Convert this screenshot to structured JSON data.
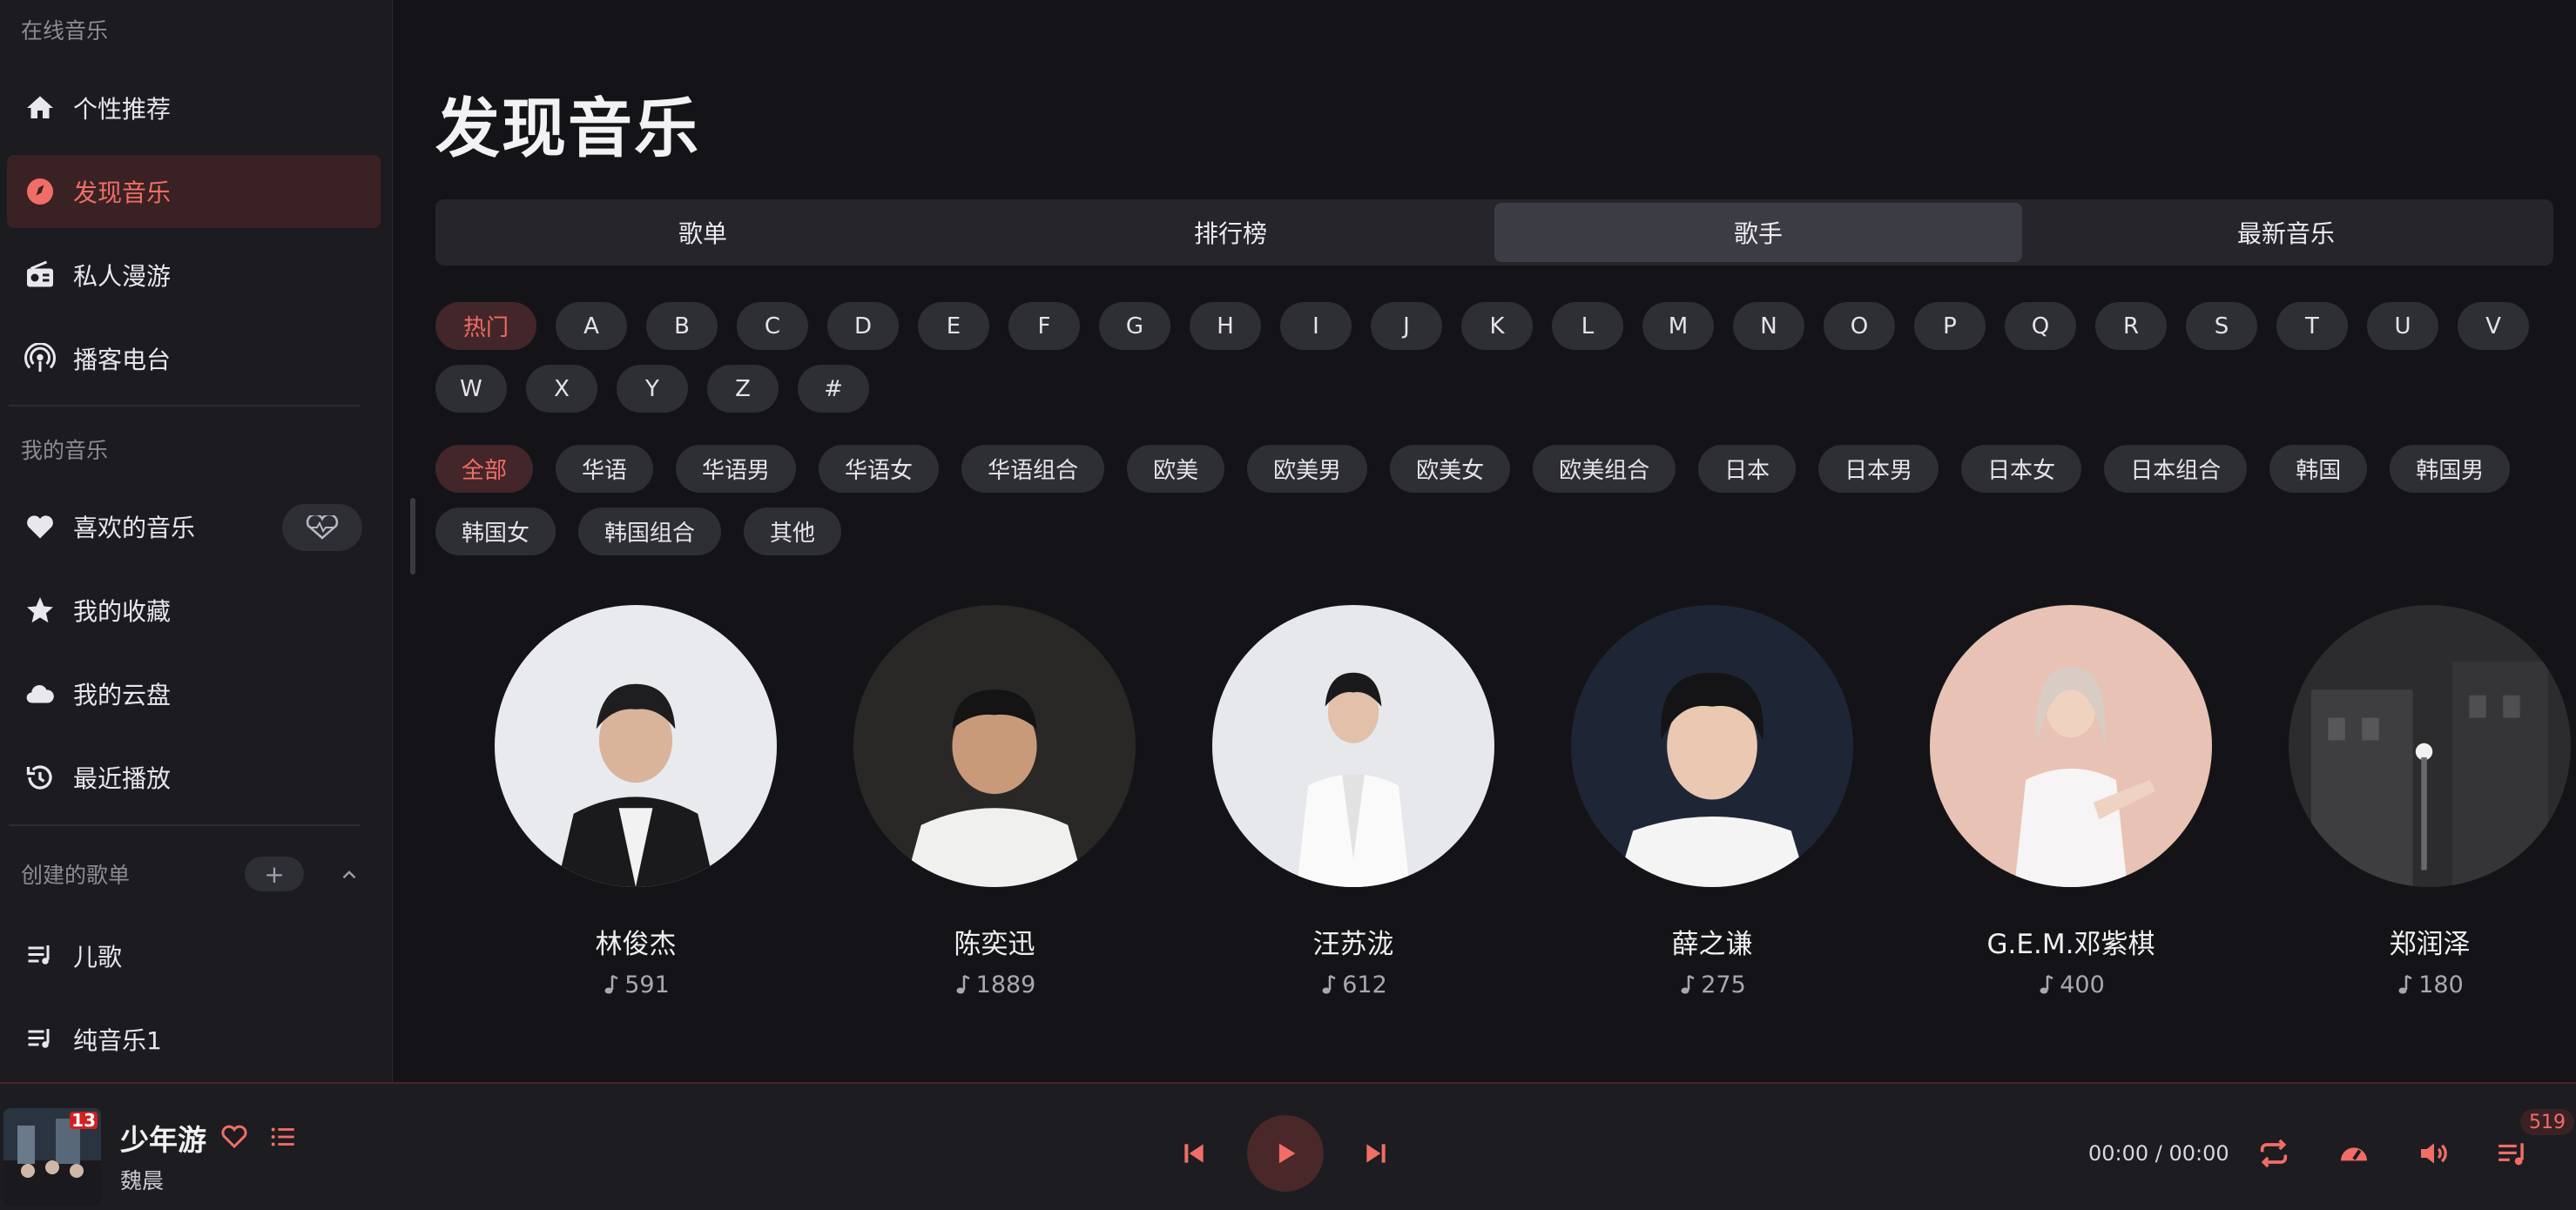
{
  "colors": {
    "accent": "#f06e66",
    "background": "#141418",
    "sidebar": "#1b1b20",
    "chip": "#2e2e35"
  },
  "sidebar": {
    "online_title": "在线音乐",
    "online_items": [
      {
        "label": "个性推荐",
        "icon": "home-icon"
      },
      {
        "label": "发现音乐",
        "icon": "disc-icon",
        "active": true
      },
      {
        "label": "私人漫游",
        "icon": "radio-icon"
      },
      {
        "label": "播客电台",
        "icon": "podcast-icon"
      }
    ],
    "my_title": "我的音乐",
    "my_items": [
      {
        "label": "喜欢的音乐",
        "icon": "heart-icon"
      },
      {
        "label": "我的收藏",
        "icon": "star-icon"
      },
      {
        "label": "我的云盘",
        "icon": "cloud-icon"
      },
      {
        "label": "最近播放",
        "icon": "history-icon"
      }
    ],
    "created_title": "创建的歌单",
    "created_add": "+",
    "playlists": [
      {
        "label": "儿歌",
        "icon": "playlist-icon"
      },
      {
        "label": "纯音乐1",
        "icon": "playlist-icon"
      }
    ]
  },
  "main": {
    "title": "发现音乐",
    "tabs": [
      {
        "label": "歌单"
      },
      {
        "label": "排行榜"
      },
      {
        "label": "歌手",
        "active": true
      },
      {
        "label": "最新音乐"
      }
    ],
    "letters": [
      "热门",
      "A",
      "B",
      "C",
      "D",
      "E",
      "F",
      "G",
      "H",
      "I",
      "J",
      "K",
      "L",
      "M",
      "N",
      "O",
      "P",
      "Q",
      "R",
      "S",
      "T",
      "U",
      "V",
      "W",
      "X",
      "Y",
      "Z",
      "#"
    ],
    "letters_active": "热门",
    "categories": [
      "全部",
      "华语",
      "华语男",
      "华语女",
      "华语组合",
      "欧美",
      "欧美男",
      "欧美女",
      "欧美组合",
      "日本",
      "日本男",
      "日本女",
      "日本组合",
      "韩国",
      "韩国男",
      "韩国女",
      "韩国组合",
      "其他"
    ],
    "categories_active": "全部",
    "artists": [
      {
        "name": "林俊杰",
        "count": "591"
      },
      {
        "name": "陈奕迅",
        "count": "1889"
      },
      {
        "name": "汪苏泷",
        "count": "612"
      },
      {
        "name": "薛之谦",
        "count": "275"
      },
      {
        "name": "G.E.M.邓紫棋",
        "count": "400"
      },
      {
        "name": "郑润泽",
        "count": "180"
      }
    ]
  },
  "player": {
    "song_title": "少年游",
    "song_artist": "魏晨",
    "cover_badge": "13",
    "time": "00:00 / 00:00",
    "queue_count": "519"
  }
}
